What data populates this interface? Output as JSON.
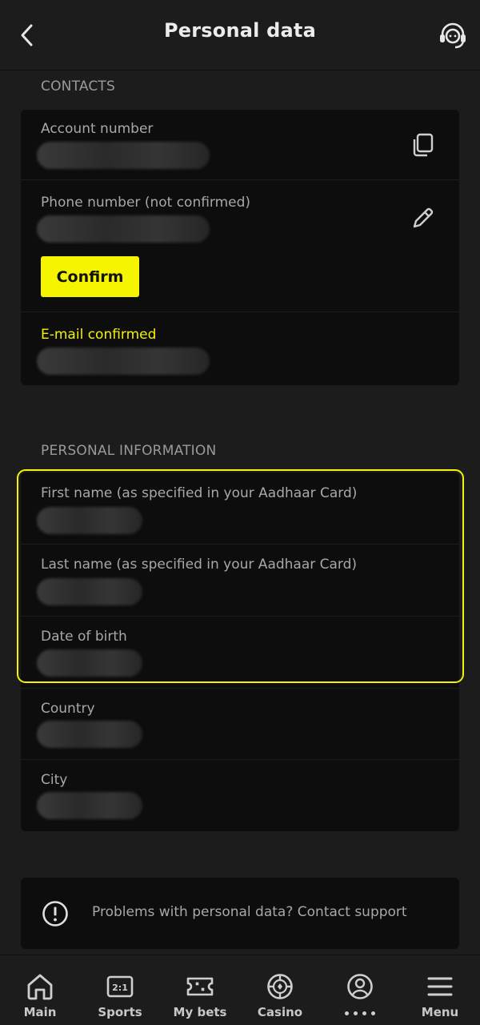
{
  "header": {
    "title": "Personal data",
    "back_icon": "chevron-left-icon",
    "support_icon": "headset-icon"
  },
  "contacts": {
    "section_label": "CONTACTS",
    "account_number_label": "Account number",
    "phone_label": "Phone number (not confirmed)",
    "confirm_button": "Confirm",
    "email_label": "E-mail confirmed"
  },
  "personal_information": {
    "section_label": "PERSONAL INFORMATION",
    "first_name_label": "First name (as specified in your Aadhaar Card)",
    "last_name_label": "Last name (as specified in your Aadhaar Card)",
    "dob_label": "Date of birth",
    "country_label": "Country",
    "city_label": "City"
  },
  "support_notice": {
    "text": "Problems with personal data? Contact support",
    "icon": "alert-circle-icon"
  },
  "bottom_nav": {
    "items": [
      {
        "label": "Main",
        "icon": "home-icon"
      },
      {
        "label": "Sports",
        "icon": "scoreboard-icon"
      },
      {
        "label": "My bets",
        "icon": "ticket-icon"
      },
      {
        "label": "Casino",
        "icon": "casino-chip-icon"
      },
      {
        "label": "",
        "icon": "profile-icon"
      },
      {
        "label": "Menu",
        "icon": "hamburger-menu-icon"
      }
    ]
  },
  "colors": {
    "background": "#1c1c1c",
    "card": "#0d0d0d",
    "accent_yellow": "#f5f500",
    "text_muted": "#a8a8a8"
  }
}
